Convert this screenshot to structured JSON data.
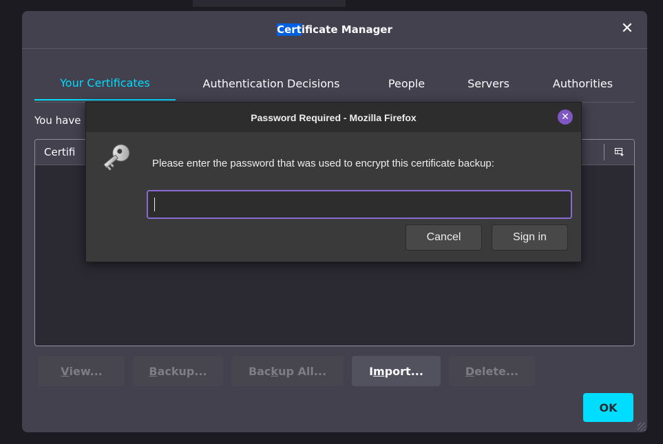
{
  "certificate_manager": {
    "title_highlight": "Cert",
    "title_rest": "ificate Manager",
    "tabs": [
      {
        "label": "Your Certificates",
        "active": true
      },
      {
        "label": "Authentication Decisions",
        "active": false
      },
      {
        "label": "People",
        "active": false
      },
      {
        "label": "Servers",
        "active": false
      },
      {
        "label": "Authorities",
        "active": false
      }
    ],
    "intro_text": "You have",
    "column_header": "Certifi",
    "buttons": [
      {
        "pre": "",
        "mnemonic": "V",
        "post": "iew...",
        "enabled": false
      },
      {
        "pre": "",
        "mnemonic": "B",
        "post": "ackup...",
        "enabled": false
      },
      {
        "pre": "Bac",
        "mnemonic": "k",
        "post": "up All...",
        "enabled": false
      },
      {
        "pre": "I",
        "mnemonic": "m",
        "post": "port...",
        "enabled": true
      },
      {
        "pre": "",
        "mnemonic": "D",
        "post": "elete...",
        "enabled": false
      }
    ],
    "ok_label": "OK",
    "colors": {
      "accent": "#00ddff",
      "background": "#42414d"
    }
  },
  "password_dialog": {
    "title": "Password Required - Mozilla Firefox",
    "message": "Please enter the password that was used to encrypt this certificate backup:",
    "input_value": "",
    "cancel_label": "Cancel",
    "signin_label": "Sign in",
    "icon": "key-icon",
    "colors": {
      "focus": "#8a6bd1",
      "close": "#7e57c2"
    }
  }
}
